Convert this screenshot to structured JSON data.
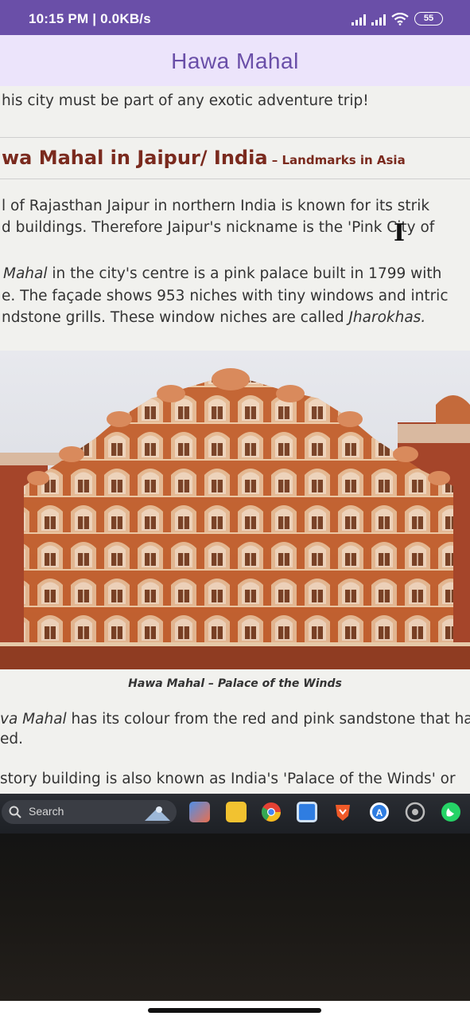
{
  "status_bar": {
    "time_speed": "10:15 PM | 0.0KB/s",
    "battery": "55",
    "bg_color": "#6a4fa8"
  },
  "app_bar": {
    "title": "Hawa Mahal",
    "bg_color": "#ece4fb",
    "title_color": "#6a4fa8"
  },
  "photo": {
    "article": {
      "line_intro": "his city must be part of any exotic adventure trip!",
      "heading_main": "wa Mahal in Jaipur/ India",
      "heading_sub": " – Landmarks in Asia",
      "para1_line1": "l of Rajasthan Jaipur in northern India is known for its strik",
      "para1_line2": "d buildings. Therefore Jaipur's nickname is the 'Pink City of",
      "para2_line1_em": "Mahal",
      "para2_line1_rest": " in the city's centre is a pink palace built in 1799 with",
      "para2_line2": "e. The façade shows 953 niches with tiny windows and intric",
      "para2_line3_pre": "ndstone grills. These window niches are called ",
      "para2_line3_em": "Jharokhas.",
      "caption": "Hawa Mahal – Palace of the Winds",
      "para3_line1_em": "va Mahal",
      "para3_line1_rest": " has its colour from the red and pink sandstone that ha",
      "para3_line2": "ed.",
      "para4_line1": " story building is also known as India's 'Palace of the Winds' or"
    },
    "taskbar": {
      "search_label": "Search",
      "icons": [
        "widgets-icon",
        "file-explorer-icon",
        "chrome-icon",
        "calendar-app-icon",
        "brave-browser-icon",
        "app-store-icon",
        "settings-icon",
        "whatsapp-icon"
      ]
    }
  }
}
